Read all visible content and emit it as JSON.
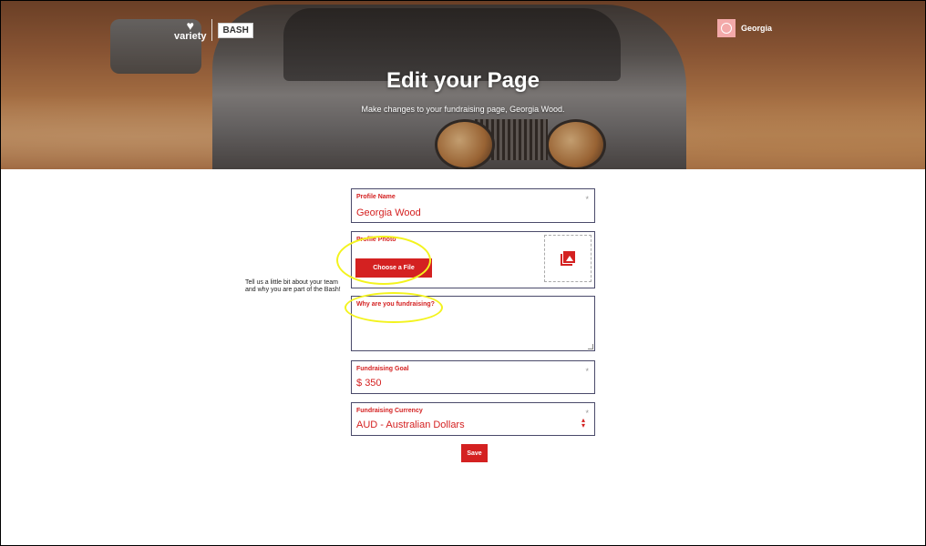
{
  "header": {
    "logo_variety": "variety",
    "logo_bash": "BASH",
    "user_name": "Georgia",
    "title": "Edit your Page",
    "subtitle": "Make changes to your fundraising page, Georgia Wood."
  },
  "form": {
    "profile_name": {
      "label": "Profile Name",
      "value": "Georgia Wood",
      "required_mark": "*"
    },
    "profile_photo": {
      "label": "Profile Photo",
      "button_label": "Choose a File"
    },
    "why": {
      "label": "Why are you fundraising?",
      "side_help": "Tell us a little bit about your team and why you are part of the Bash!"
    },
    "goal": {
      "label": "Fundraising Goal",
      "currency_symbol": "$",
      "value": "350",
      "required_mark": "*"
    },
    "currency": {
      "label": "Fundraising Currency",
      "value": "AUD - Australian Dollars",
      "required_mark": "*"
    },
    "save_label": "Save"
  },
  "colors": {
    "accent": "#d42121",
    "annotation": "#f3f31e"
  }
}
